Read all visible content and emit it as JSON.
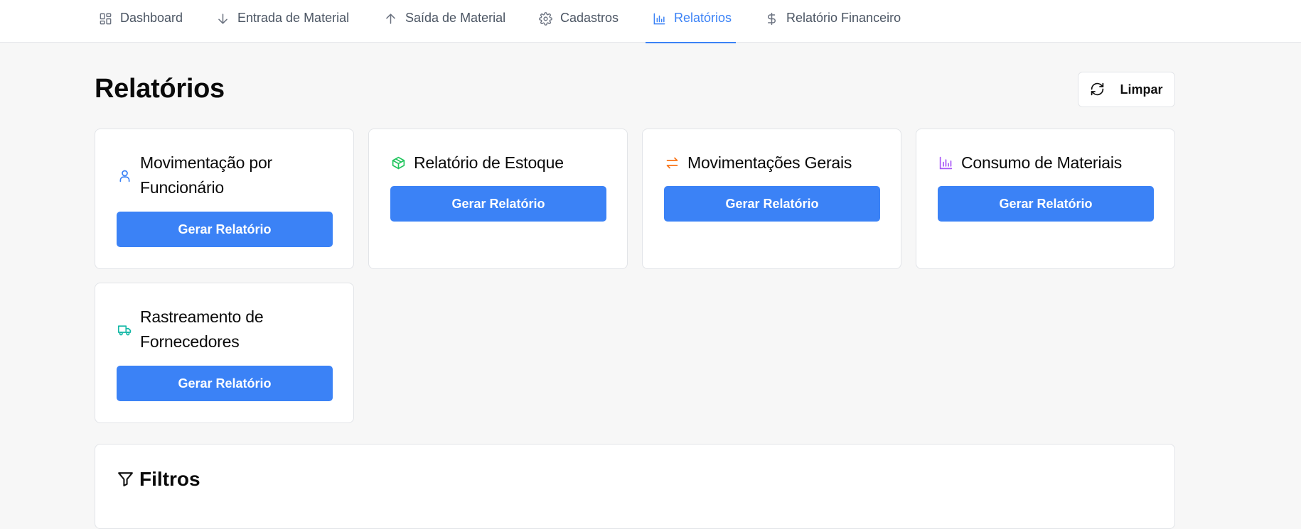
{
  "nav": {
    "items": [
      {
        "label": "Dashboard",
        "icon": "dashboard-icon",
        "active": false
      },
      {
        "label": "Entrada de Material",
        "icon": "arrow-down-icon",
        "active": false
      },
      {
        "label": "Saída de Material",
        "icon": "arrow-up-icon",
        "active": false
      },
      {
        "label": "Cadastros",
        "icon": "gear-icon",
        "active": false
      },
      {
        "label": "Relatórios",
        "icon": "bar-chart-icon",
        "active": true
      },
      {
        "label": "Relatório Financeiro",
        "icon": "dollar-icon",
        "active": false
      }
    ],
    "active_color": "#3b82f6"
  },
  "header": {
    "title": "Relatórios",
    "clear_label": "Limpar"
  },
  "reports": [
    {
      "title": "Movimentação por Funcionário",
      "icon": "user-icon",
      "icon_color": "#3b82f6",
      "button": "Gerar Relatório"
    },
    {
      "title": "Relatório de Estoque",
      "icon": "package-icon",
      "icon_color": "#22c55e",
      "button": "Gerar Relatório"
    },
    {
      "title": "Movimentações Gerais",
      "icon": "swap-arrows-icon",
      "icon_color": "#f97316",
      "button": "Gerar Relatório"
    },
    {
      "title": "Consumo de Materiais",
      "icon": "bar-chart-icon",
      "icon_color": "#a855f7",
      "button": "Gerar Relatório"
    },
    {
      "title": "Rastreamento de Fornecedores",
      "icon": "truck-icon",
      "icon_color": "#14b8a6",
      "button": "Gerar Relatório"
    }
  ],
  "filters": {
    "title": "Filtros",
    "icon": "filter-icon"
  },
  "colors": {
    "primary_button": "#3b82f6",
    "background": "#f7f7f7"
  }
}
